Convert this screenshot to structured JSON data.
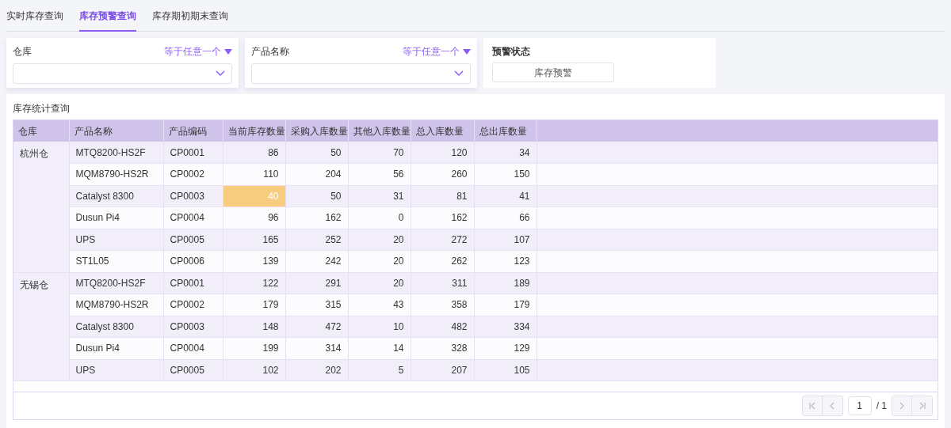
{
  "tabs": [
    {
      "label": "实时库存查询",
      "selected": false
    },
    {
      "label": "库存预警查询",
      "selected": true
    },
    {
      "label": "库存期初期末查询",
      "selected": false
    }
  ],
  "filters": [
    {
      "kind": "select",
      "label": "仓库",
      "operator": "等于任意一个"
    },
    {
      "kind": "select",
      "label": "产品名称",
      "operator": "等于任意一个"
    },
    {
      "kind": "button",
      "label": "预警状态",
      "button": "库存预警"
    }
  ],
  "table": {
    "title": "库存统计查询",
    "columns": [
      "仓库",
      "产品名称",
      "产品编码",
      "当前库存数量",
      "采购入库数量",
      "其他入库数量",
      "总入库数量",
      "总出库数量"
    ],
    "groups": [
      {
        "warehouse": "杭州仓",
        "rows": [
          {
            "cells": [
              "MTQ8200-HS2F",
              "CP0001",
              "86",
              "50",
              "70",
              "120",
              "34"
            ],
            "warning": false
          },
          {
            "cells": [
              "MQM8790-HS2R",
              "CP0002",
              "110",
              "204",
              "56",
              "260",
              "150"
            ],
            "warning": false
          },
          {
            "cells": [
              "Catalyst 8300",
              "CP0003",
              "40",
              "50",
              "31",
              "81",
              "41"
            ],
            "warning": true
          },
          {
            "cells": [
              "Dusun Pi4",
              "CP0004",
              "96",
              "162",
              "0",
              "162",
              "66"
            ],
            "warning": false
          },
          {
            "cells": [
              "UPS",
              "CP0005",
              "165",
              "252",
              "20",
              "272",
              "107"
            ],
            "warning": false
          },
          {
            "cells": [
              "ST1L05",
              "CP0006",
              "139",
              "242",
              "20",
              "262",
              "123"
            ],
            "warning": false
          }
        ]
      },
      {
        "warehouse": "无锡仓",
        "rows": [
          {
            "cells": [
              "MTQ8200-HS2F",
              "CP0001",
              "122",
              "291",
              "20",
              "311",
              "189"
            ],
            "warning": false
          },
          {
            "cells": [
              "MQM8790-HS2R",
              "CP0002",
              "179",
              "315",
              "43",
              "358",
              "179"
            ],
            "warning": false
          },
          {
            "cells": [
              "Catalyst 8300",
              "CP0003",
              "148",
              "472",
              "10",
              "482",
              "334"
            ],
            "warning": false
          },
          {
            "cells": [
              "Dusun Pi4",
              "CP0004",
              "199",
              "314",
              "14",
              "328",
              "129"
            ],
            "warning": false
          },
          {
            "cells": [
              "UPS",
              "CP0005",
              "102",
              "202",
              "5",
              "207",
              "105"
            ],
            "warning": false
          }
        ]
      }
    ]
  },
  "pagination": {
    "page": "1",
    "total": "/ 1",
    "first_disabled": true,
    "last_disabled": true
  }
}
